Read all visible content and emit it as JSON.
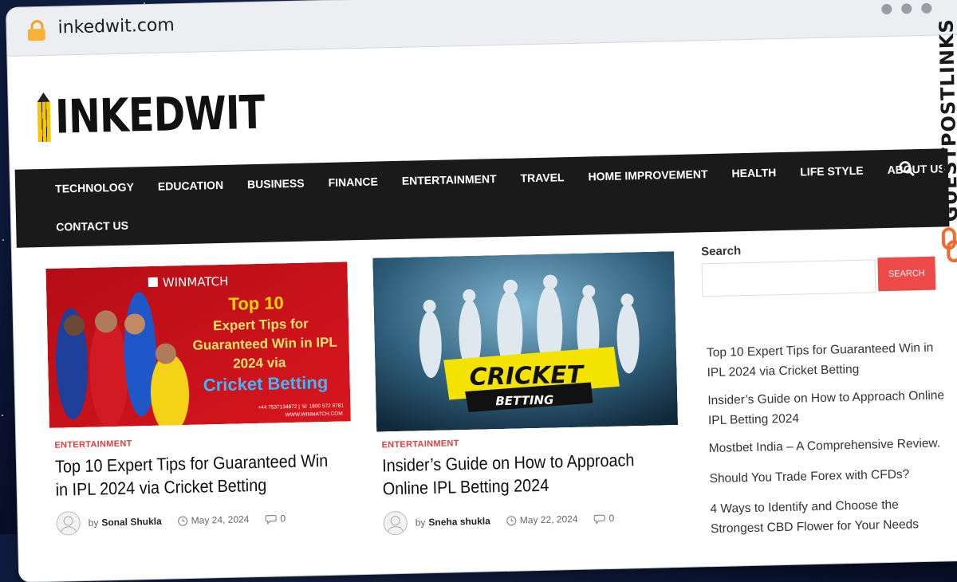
{
  "browser": {
    "url": "inkedwit.com"
  },
  "site": {
    "logo": "INKEDWIT"
  },
  "watermark": {
    "text": "GUESTPOSTLINKS"
  },
  "nav": {
    "items": [
      "TECHNOLOGY",
      "EDUCATION",
      "BUSINESS",
      "FINANCE",
      "ENTERTAINMENT",
      "TRAVEL",
      "HOME IMPROVEMENT",
      "HEALTH",
      "LIFE STYLE",
      "ABOUT US"
    ],
    "items_row2": [
      "CONTACT US"
    ]
  },
  "posts": [
    {
      "category": "ENTERTAINMENT",
      "title": "Top 10 Expert Tips for Guaranteed Win in IPL 2024 via Cricket Betting",
      "by": "by",
      "author": "Sonal Shukla",
      "date": "May 24, 2024",
      "comments": "0",
      "image": {
        "brand": "WINMATCH",
        "line1": "Top 10",
        "line2": "Expert Tips for",
        "line3": "Guaranteed Win in IPL",
        "line4": "2024 via",
        "line5": "Cricket Betting",
        "contact": "+44 7537134872 | ☏ 1800 572 8781",
        "website": "WWW.WINMATCH.COM"
      }
    },
    {
      "category": "ENTERTAINMENT",
      "title": "Insider’s Guide on How to Approach Online IPL Betting 2024",
      "by": "by",
      "author": "Sneha shukla",
      "date": "May 22, 2024",
      "comments": "0",
      "image": {
        "line1": "CRICKET",
        "line2": "BETTING"
      }
    }
  ],
  "sidebar": {
    "search_title": "Search",
    "search_button": "SEARCH",
    "recent": [
      "Top 10 Expert Tips for Guaranteed Win in IPL 2024 via Cricket Betting",
      "Insider’s Guide on How to Approach Online IPL Betting 2024",
      "Mostbet India – A Comprehensive Review.",
      "Should You Trade Forex with CFDs?",
      "4 Ways to Identify and Choose the Strongest CBD Flower for Your Needs"
    ]
  },
  "colors": {
    "accent": "#ee4a4a",
    "nav_bg": "#1a1a1a",
    "category": "#e34040"
  }
}
